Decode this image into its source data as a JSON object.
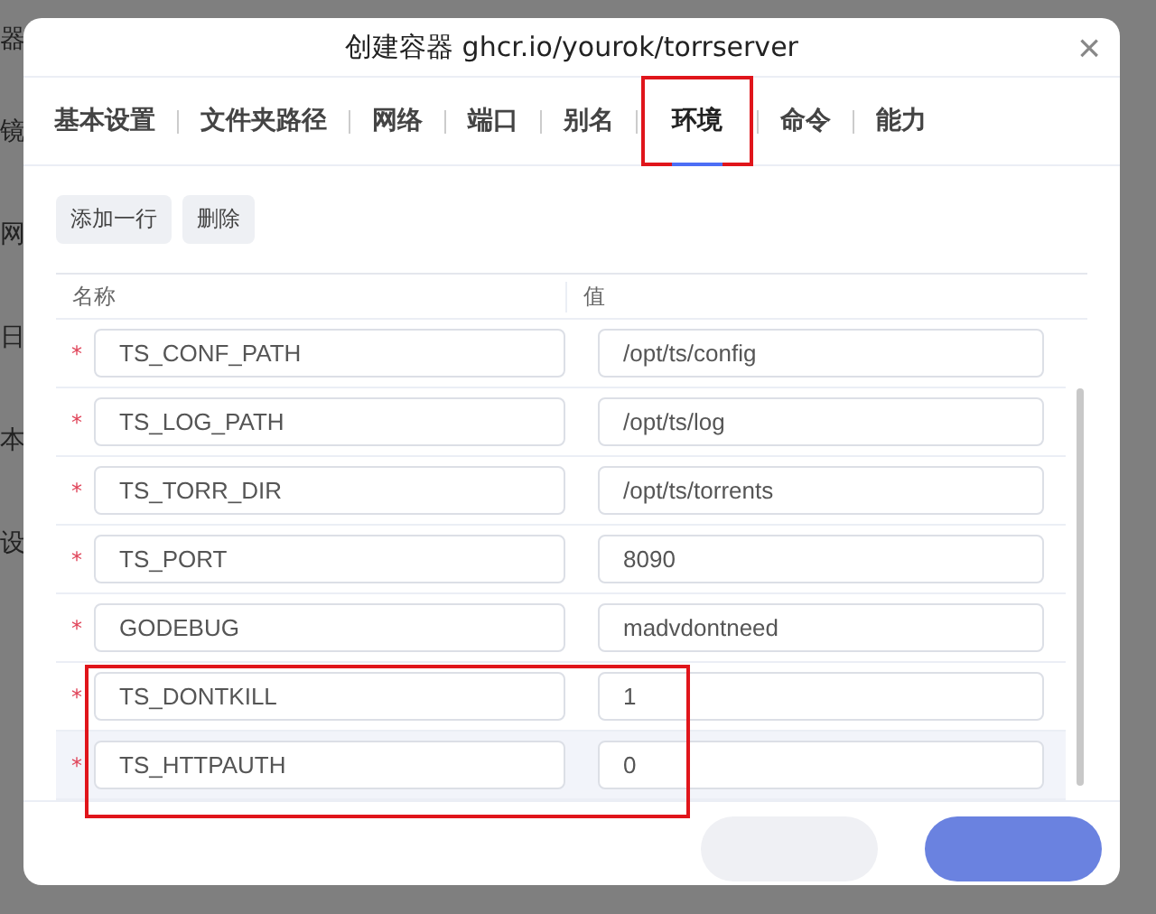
{
  "background": {
    "sidebar_fragments": [
      "器",
      "镜",
      "网",
      "日",
      "本",
      "设"
    ]
  },
  "dialog": {
    "title": "创建容器 ghcr.io/yourok/torrserver",
    "close": "×"
  },
  "tabs": [
    {
      "label": "基本设置",
      "selected": false,
      "highlighted": false
    },
    {
      "label": "文件夹路径",
      "selected": false,
      "highlighted": false
    },
    {
      "label": "网络",
      "selected": false,
      "highlighted": false
    },
    {
      "label": "端口",
      "selected": false,
      "highlighted": false
    },
    {
      "label": "别名",
      "selected": false,
      "highlighted": false
    },
    {
      "label": "环境",
      "selected": true,
      "highlighted": true
    },
    {
      "label": "命令",
      "selected": false,
      "highlighted": false
    },
    {
      "label": "能力",
      "selected": false,
      "highlighted": false
    }
  ],
  "toolbar": [
    "添加一行",
    "删除"
  ],
  "table": {
    "columns": [
      "名称",
      "值"
    ],
    "rows": [
      {
        "required": "*",
        "name": "TS_CONF_PATH",
        "value": "/opt/ts/config",
        "hovered": false,
        "highlighted": false
      },
      {
        "required": "*",
        "name": "TS_LOG_PATH",
        "value": "/opt/ts/log",
        "hovered": false,
        "highlighted": false
      },
      {
        "required": "*",
        "name": "TS_TORR_DIR",
        "value": "/opt/ts/torrents",
        "hovered": false,
        "highlighted": false
      },
      {
        "required": "*",
        "name": "TS_PORT",
        "value": "8090",
        "hovered": false,
        "highlighted": false
      },
      {
        "required": "*",
        "name": "GODEBUG",
        "value": "madvdontneed",
        "hovered": false,
        "highlighted": false
      },
      {
        "required": "*",
        "name": "TS_DONTKILL",
        "value": "1",
        "hovered": false,
        "highlighted": true
      },
      {
        "required": "*",
        "name": "TS_HTTPAUTH",
        "value": "0",
        "hovered": true,
        "highlighted": true
      }
    ]
  },
  "footer": [
    {
      "kind": "secondary"
    },
    {
      "kind": "primary"
    }
  ]
}
